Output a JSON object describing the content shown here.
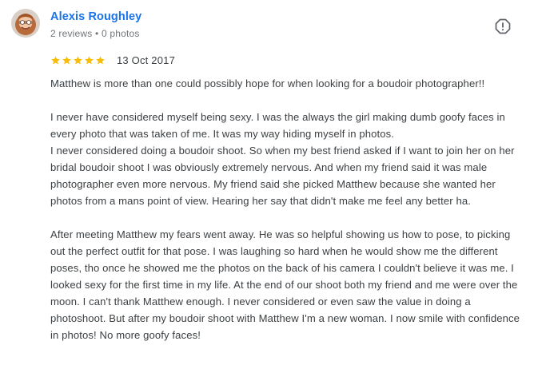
{
  "reviewer": {
    "name": "Alexis Roughley",
    "meta": "2 reviews • 0 photos"
  },
  "rating": {
    "stars": 5,
    "max": 5,
    "star_color": "#fbbc04",
    "date": "13 Oct 2017"
  },
  "colors": {
    "name_link": "#1a73e8",
    "text": "#3c4043",
    "meta": "#70757a"
  },
  "icons": {
    "report": "report-flag-icon",
    "star": "star-icon",
    "avatar": "avatar"
  },
  "review": {
    "paragraphs": [
      [
        "Matthew is more than one could possibly hope for when looking for a boudoir photographer!!"
      ],
      [
        "I never have considered myself being sexy. I was the always the girl making dumb goofy faces in every photo that was taken of me. It was my way hiding myself in photos.",
        "I never considered doing a boudoir shoot. So when my best friend asked if I want to join her on her bridal boudoir shoot I was obviously extremely nervous. And when my friend said it was male photographer even more nervous. My friend said she picked Matthew because she wanted her photos from a mans point of view. Hearing her say that didn't make me feel any better ha."
      ],
      [
        "After meeting Matthew my fears went away. He was so helpful showing us how to pose, to picking out the perfect outfit for that pose. I was laughing so hard when he would show me the different poses, tho once he showed me the photos on the back of his camera I couldn't believe it was me. I looked sexy for the first time in my life. At the end of our shoot both my friend and me were over the moon. I can't thank Matthew enough. I never considered or even saw the value in doing a photoshoot. But after my boudoir shoot with Matthew I'm a new woman. I now smile with confidence in photos! No more goofy faces!"
      ]
    ]
  }
}
